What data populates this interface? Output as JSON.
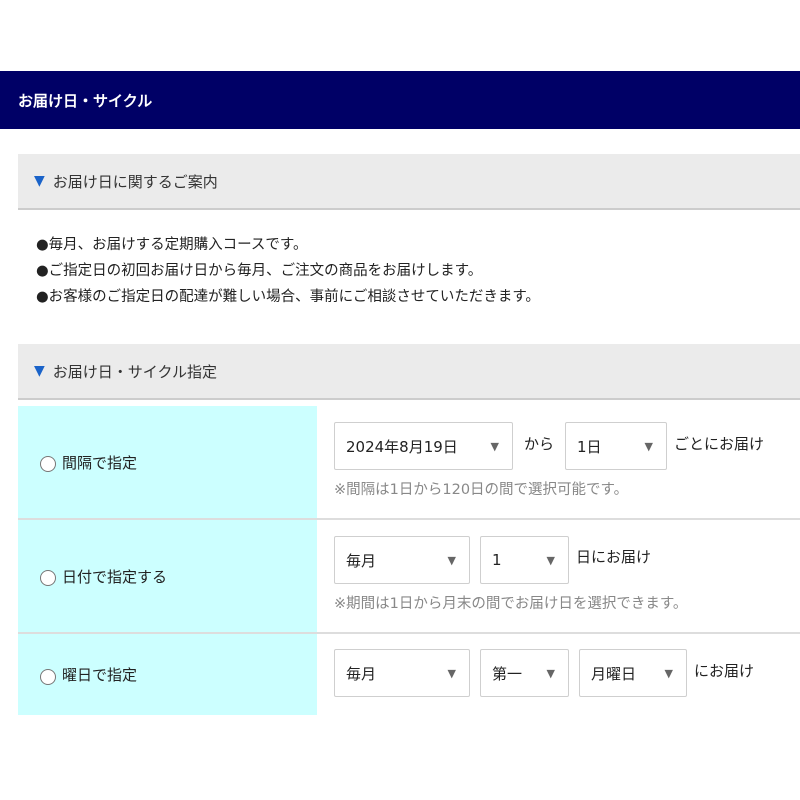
{
  "header": {
    "title": "お届け日・サイクル"
  },
  "guide": {
    "title": "お届け日に関するご案内",
    "lines": [
      "●毎月、お届けする定期購入コースです。",
      "●ご指定日の初回お届け日から毎月、ご注文の商品をお届けします。",
      "●お客様のご指定日の配達が難しい場合、事前にご相談させていただきます。"
    ]
  },
  "cycle": {
    "title": "お届け日・サイクル指定",
    "interval": {
      "label": "間隔で指定",
      "start_date": "2024年8月19日",
      "from_text": "から",
      "interval_value": "1日",
      "suffix": "ごとにお届け",
      "note": "※間隔は1日から120日の間で選択可能です。"
    },
    "date": {
      "label": "日付で指定する",
      "frequency": "毎月",
      "day": "1",
      "suffix": "日にお届け",
      "note": "※期間は1日から月末の間でお届け日を選択できます。"
    },
    "weekday": {
      "label": "曜日で指定",
      "frequency": "毎月",
      "week": "第一",
      "day_of_week": "月曜日",
      "suffix": "にお届け"
    }
  },
  "icons": {
    "triangle": "▼",
    "dropdown": "▼"
  },
  "colors": {
    "header_bg": "#000066",
    "section_bg": "#ebebeb",
    "option_bg": "#ccffff",
    "triangle": "#1a63c9",
    "note_text": "#888888"
  }
}
